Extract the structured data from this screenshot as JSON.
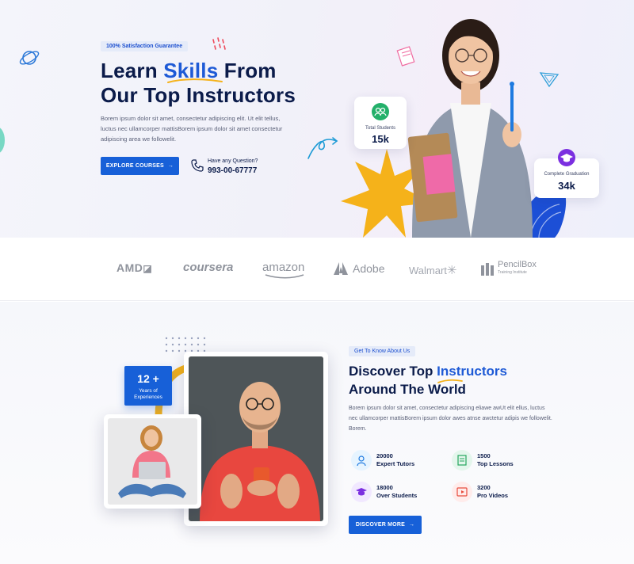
{
  "hero": {
    "badge": "100% Satisfaction Guarantee",
    "title_part1": "Learn ",
    "title_highlight": "Skills",
    "title_part2": " From",
    "title_line2": "Our Top Instructors",
    "description": "Borem ipsum dolor sit amet, consectetur adipiscing elit. Ut elit tellus, luctus nec ullamcorper mattisBorem ipsum dolor sit amet consectetur adipiscing area we followelit.",
    "explore_button": "EXPLORE COURSES",
    "question_label": "Have any Question?",
    "phone": "993-00-67777",
    "stats": [
      {
        "label": "Total Students",
        "value": "15k",
        "icon": "users-icon"
      },
      {
        "label": "Complete Graduation",
        "value": "34k",
        "icon": "graduation-cap-icon"
      }
    ]
  },
  "logos": [
    "AMD",
    "coursera",
    "amazon",
    "Adobe",
    "Walmart",
    "PencilBox",
    "Training Institute"
  ],
  "about": {
    "tag": "Get To Know About Us",
    "title_part1": "Discover Top ",
    "title_highlight": "Instructors",
    "title_line2": "Around The World",
    "description": "Borem ipsum dolor sit amet, consectetur adipiscing eliawe awUt elit ellus, luctus nec ullamcorper mattisBorem ipsum dolor awes atnse awctetur adipis we followelit. Borem.",
    "experience_number": "12 +",
    "experience_label1": "Years of",
    "experience_label2": "Experiences",
    "features": [
      {
        "number": "20000",
        "label": "Expert Tutors",
        "icon": "tutor-icon",
        "color": "#e6f4ff"
      },
      {
        "number": "1500",
        "label": "Top Lessons",
        "icon": "lessons-icon",
        "color": "#e4f6ec"
      },
      {
        "number": "18000",
        "label": "Over Students",
        "icon": "students-icon",
        "color": "#f1e8ff"
      },
      {
        "number": "3200",
        "label": "Pro Videos",
        "icon": "video-icon",
        "color": "#ffeceb"
      }
    ],
    "discover_button": "DISCOVER MORE"
  },
  "colors": {
    "primary": "#1760d8",
    "navy": "#0b1b4a",
    "accent_yellow": "#f5b21a",
    "accent_green": "#23b06a",
    "accent_purple": "#7b2fe0"
  }
}
